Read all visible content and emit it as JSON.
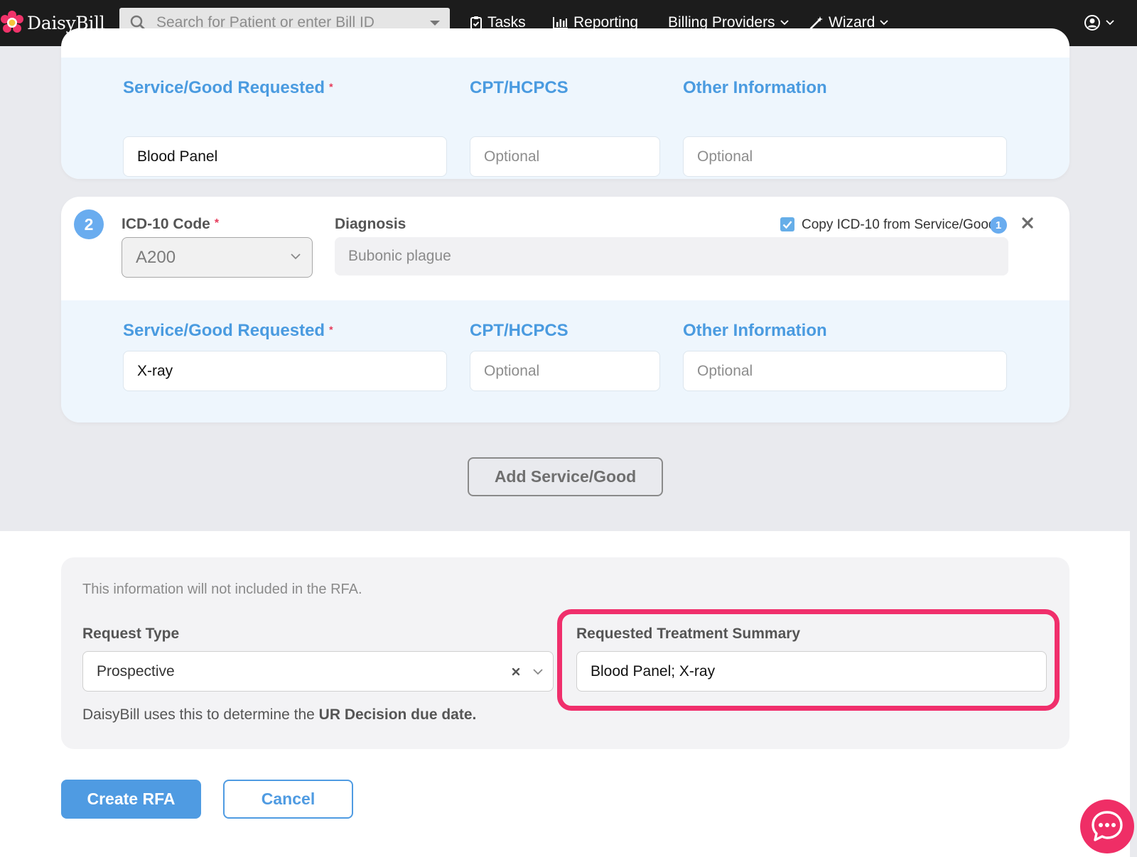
{
  "nav": {
    "brand": "DaisyBill",
    "search_placeholder": "Search for Patient or enter Bill ID",
    "tasks": "Tasks",
    "reporting": "Reporting",
    "billing_providers": "Billing Providers",
    "wizard": "Wizard"
  },
  "service_block_1": {
    "service_label": "Service/Good Requested",
    "required_mark": "*",
    "cpt_label": "CPT/HCPCS",
    "other_label": "Other Information",
    "service_value": "Blood Panel",
    "cpt_placeholder": "Optional",
    "other_placeholder": "Optional"
  },
  "diagnosis_block_2": {
    "number": "2",
    "icd_label": "ICD-10 Code",
    "required_mark": "*",
    "icd_value": "A200",
    "diagnosis_label": "Diagnosis",
    "diagnosis_value": "Bubonic plague",
    "copy_label": "Copy ICD-10 from Service/Good",
    "copy_badge": "1",
    "copy_checked": true
  },
  "service_block_2": {
    "service_label": "Service/Good Requested",
    "required_mark": "*",
    "cpt_label": "CPT/HCPCS",
    "other_label": "Other Information",
    "service_value": "X-ray",
    "cpt_placeholder": "Optional",
    "other_placeholder": "Optional"
  },
  "add_service_button": "Add Service/Good",
  "info_panel": {
    "note": "This information will not included in the RFA.",
    "request_type_label": "Request Type",
    "request_type_value": "Prospective",
    "request_type_hint_prefix": "DaisyBill uses this to determine the",
    "request_type_hint_bold": "UR Decision due date.",
    "summary_label": "Requested Treatment Summary",
    "summary_value": "Blood Panel; X-ray"
  },
  "actions": {
    "create": "Create RFA",
    "cancel": "Cancel"
  },
  "colors": {
    "accent": "#4f9be2",
    "highlight": "#f02f6c",
    "topbar": "#1c1c1c"
  }
}
